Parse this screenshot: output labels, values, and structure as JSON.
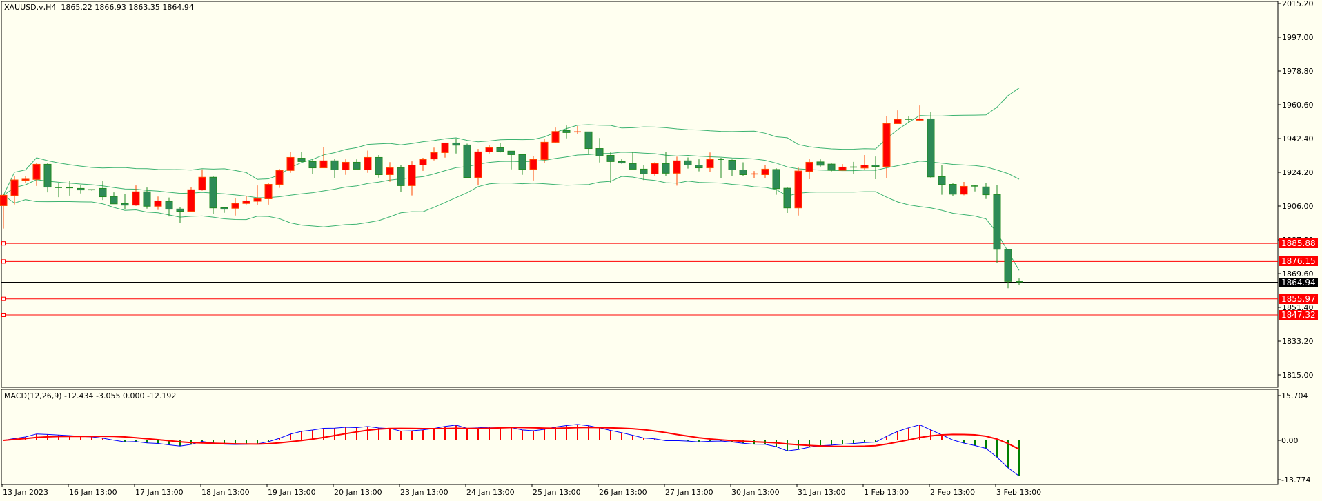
{
  "header": {
    "symbol": "XAUUSD.v,H4",
    "open": "1865.22",
    "high": "1866.93",
    "low": "1863.35",
    "close": "1864.94"
  },
  "colors": {
    "background": "#FFFFF0",
    "bull": "#FF0000",
    "bull_border": "#FF4500",
    "bear": "#2E8B57",
    "bear_wick": "#228B22",
    "bands": "#3CB371",
    "level": "#FF0000",
    "macd_line": "#0000FF",
    "signal_line": "#FF0000"
  },
  "price_axis": {
    "labels": [
      "2015.20",
      "1997.00",
      "1978.80",
      "1960.60",
      "1942.40",
      "1924.20",
      "1906.00",
      "1887.80",
      "1869.60",
      "1851.40",
      "1833.20",
      "1815.00"
    ],
    "max": 2015.2,
    "min": 1815.0
  },
  "levels": [
    {
      "price": 1885.88,
      "label": "1885.88",
      "color": "#FF0000"
    },
    {
      "price": 1876.15,
      "label": "1876.15",
      "color": "#FF0000"
    },
    {
      "price": 1864.94,
      "label": "1864.94",
      "color": "#000000"
    },
    {
      "price": 1855.97,
      "label": "1855.97",
      "color": "#FF0000"
    },
    {
      "price": 1847.32,
      "label": "1847.32",
      "color": "#FF0000"
    }
  ],
  "macd": {
    "title": "MACD(12,26,9) -12.434 -3.055 0.000 -12.192",
    "axis_labels": [
      "15.704",
      "0.00",
      "-13.774"
    ],
    "max": 15.704,
    "min": -13.774
  },
  "time_axis": [
    "13 Jan 2023",
    "16 Jan 13:00",
    "17 Jan 13:00",
    "18 Jan 13:00",
    "19 Jan 13:00",
    "20 Jan 13:00",
    "23 Jan 13:00",
    "24 Jan 13:00",
    "25 Jan 13:00",
    "26 Jan 13:00",
    "27 Jan 13:00",
    "30 Jan 13:00",
    "31 Jan 13:00",
    "1 Feb 13:00",
    "2 Feb 13:00",
    "3 Feb 13:00"
  ],
  "chart_data": {
    "type": "candlestick",
    "title": "XAUUSD.v,H4",
    "ylim": [
      1815.0,
      2015.2
    ],
    "ohlc": [
      [
        1906.2,
        1912.7,
        1893.9,
        1911.8
      ],
      [
        1911.7,
        1922.3,
        1906.9,
        1920.1
      ],
      [
        1919.9,
        1922.0,
        1918.3,
        1920.5
      ],
      [
        1920.4,
        1929.2,
        1916.8,
        1928.5
      ],
      [
        1928.5,
        1929.4,
        1913.4,
        1916.2
      ],
      [
        1916.0,
        1918.3,
        1910.8,
        1915.9
      ],
      [
        1915.9,
        1919.7,
        1911.6,
        1915.4
      ],
      [
        1915.5,
        1917.5,
        1912.8,
        1914.7
      ],
      [
        1914.8,
        1914.8,
        1914.3,
        1914.6
      ],
      [
        1915.5,
        1919.4,
        1909.3,
        1911.0
      ],
      [
        1911.1,
        1913.4,
        1907.2,
        1907.2
      ],
      [
        1907.4,
        1912.3,
        1904.1,
        1906.5
      ],
      [
        1906.5,
        1917.1,
        1906.1,
        1913.7
      ],
      [
        1913.7,
        1916.0,
        1904.6,
        1905.9
      ],
      [
        1905.9,
        1911.1,
        1903.9,
        1908.8
      ],
      [
        1908.5,
        1910.6,
        1900.4,
        1904.3
      ],
      [
        1904.4,
        1905.6,
        1896.7,
        1903.2
      ],
      [
        1903.2,
        1916.4,
        1903.2,
        1914.8
      ],
      [
        1914.7,
        1925.8,
        1914.3,
        1921.5
      ],
      [
        1921.5,
        1922.3,
        1901.7,
        1905.0
      ],
      [
        1905.1,
        1905.1,
        1902.4,
        1904.3
      ],
      [
        1904.8,
        1910.1,
        1900.9,
        1907.4
      ],
      [
        1907.4,
        1911.2,
        1906.9,
        1908.8
      ],
      [
        1908.6,
        1917.1,
        1906.5,
        1910.0
      ],
      [
        1909.9,
        1918.5,
        1906.8,
        1917.7
      ],
      [
        1917.7,
        1926.0,
        1915.8,
        1925.2
      ],
      [
        1925.2,
        1935.3,
        1923.9,
        1932.2
      ],
      [
        1931.8,
        1935.0,
        1929.7,
        1930.0
      ],
      [
        1930.0,
        1931.0,
        1923.2,
        1926.6
      ],
      [
        1926.6,
        1937.9,
        1926.6,
        1930.4
      ],
      [
        1930.4,
        1931.6,
        1921.0,
        1925.5
      ],
      [
        1925.5,
        1931.2,
        1922.8,
        1929.6
      ],
      [
        1929.6,
        1931.2,
        1925.9,
        1925.9
      ],
      [
        1925.5,
        1935.9,
        1923.9,
        1932.2
      ],
      [
        1932.2,
        1933.5,
        1921.3,
        1922.9
      ],
      [
        1922.9,
        1929.7,
        1919.1,
        1926.6
      ],
      [
        1926.6,
        1928.1,
        1913.5,
        1917.0
      ],
      [
        1917.0,
        1930.1,
        1911.7,
        1928.1
      ],
      [
        1928.1,
        1932.0,
        1925.0,
        1931.1
      ],
      [
        1931.4,
        1937.5,
        1930.6,
        1934.8
      ],
      [
        1934.8,
        1940.0,
        1932.1,
        1940.0
      ],
      [
        1940.0,
        1942.5,
        1934.3,
        1938.8
      ],
      [
        1938.9,
        1939.6,
        1921.4,
        1921.4
      ],
      [
        1921.4,
        1936.8,
        1917.1,
        1935.2
      ],
      [
        1935.2,
        1938.7,
        1934.3,
        1937.4
      ],
      [
        1937.4,
        1940.1,
        1934.9,
        1935.4
      ],
      [
        1935.6,
        1935.6,
        1925.8,
        1933.7
      ],
      [
        1933.7,
        1934.2,
        1922.8,
        1925.8
      ],
      [
        1925.8,
        1933.1,
        1919.8,
        1931.1
      ],
      [
        1931.1,
        1942.4,
        1929.1,
        1940.4
      ],
      [
        1940.4,
        1948.3,
        1939.9,
        1946.2
      ],
      [
        1946.7,
        1949.4,
        1942.5,
        1945.6
      ],
      [
        1945.6,
        1949.1,
        1944.8,
        1946.0
      ],
      [
        1946.0,
        1946.0,
        1933.8,
        1937.0
      ],
      [
        1937.0,
        1942.7,
        1929.5,
        1933.0
      ],
      [
        1933.3,
        1935.2,
        1918.6,
        1930.0
      ],
      [
        1930.0,
        1931.6,
        1928.8,
        1929.2
      ],
      [
        1928.9,
        1935.2,
        1925.9,
        1925.9
      ],
      [
        1925.9,
        1927.9,
        1920.0,
        1923.3
      ],
      [
        1923.3,
        1929.6,
        1922.4,
        1928.9
      ],
      [
        1928.9,
        1935.2,
        1922.1,
        1923.7
      ],
      [
        1923.7,
        1932.6,
        1917.0,
        1930.4
      ],
      [
        1930.4,
        1932.2,
        1926.2,
        1928.1
      ],
      [
        1928.1,
        1931.2,
        1924.7,
        1926.6
      ],
      [
        1926.6,
        1934.9,
        1924.3,
        1931.1
      ],
      [
        1931.2,
        1932.0,
        1921.0,
        1930.7
      ],
      [
        1930.7,
        1931.1,
        1922.1,
        1925.5
      ],
      [
        1925.5,
        1929.6,
        1922.1,
        1922.9
      ],
      [
        1922.9,
        1924.9,
        1921.0,
        1923.3
      ],
      [
        1922.9,
        1927.9,
        1921.0,
        1925.9
      ],
      [
        1925.7,
        1926.4,
        1912.1,
        1915.4
      ],
      [
        1915.6,
        1916.3,
        1902.3,
        1905.0
      ],
      [
        1905.0,
        1926.7,
        1900.9,
        1924.9
      ],
      [
        1924.7,
        1931.6,
        1920.5,
        1929.6
      ],
      [
        1929.8,
        1931.2,
        1927.2,
        1928.0
      ],
      [
        1928.6,
        1929.0,
        1924.7,
        1925.3
      ],
      [
        1925.3,
        1928.6,
        1925.3,
        1927.0
      ],
      [
        1927.0,
        1929.8,
        1923.1,
        1926.5
      ],
      [
        1926.5,
        1933.5,
        1925.7,
        1928.1
      ],
      [
        1928.1,
        1932.7,
        1920.5,
        1927.3
      ],
      [
        1927.3,
        1954.6,
        1921.2,
        1950.4
      ],
      [
        1950.4,
        1957.6,
        1950.4,
        1952.7
      ],
      [
        1952.8,
        1954.5,
        1950.9,
        1952.3
      ],
      [
        1952.3,
        1960.2,
        1951.8,
        1953.0
      ],
      [
        1953.0,
        1956.9,
        1921.3,
        1921.7
      ],
      [
        1921.8,
        1927.9,
        1912.1,
        1917.6
      ],
      [
        1917.7,
        1918.2,
        1911.2,
        1912.4
      ],
      [
        1912.4,
        1919.0,
        1911.8,
        1916.6
      ],
      [
        1916.8,
        1917.4,
        1913.9,
        1916.3
      ],
      [
        1916.3,
        1918.6,
        1909.8,
        1912.1
      ],
      [
        1912.2,
        1917.4,
        1875.5,
        1882.7
      ],
      [
        1882.7,
        1882.7,
        1861.7,
        1865.4
      ],
      [
        1865.22,
        1866.93,
        1863.35,
        1864.94
      ]
    ],
    "indicators": {
      "bollinger": {
        "period": 20,
        "deviations": 2
      },
      "macd": {
        "fast": 12,
        "slow": 26,
        "signal": 9
      }
    }
  }
}
